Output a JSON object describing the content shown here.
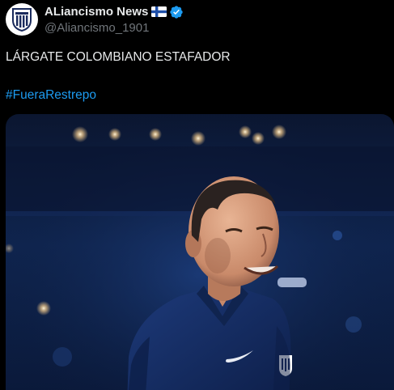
{
  "account": {
    "display_name": "ALiancismo News",
    "handle": "@Aliancismo_1901",
    "flag_icon": "finland-flag-icon",
    "verified_icon": "verified-badge-icon",
    "verified_color": "#1d9bf0"
  },
  "tweet": {
    "text": "LÁRGATE COLOMBIANO ESTAFADOR",
    "hashtag": "#FueraRestrepo"
  },
  "media": {
    "type": "photo"
  },
  "colors": {
    "background": "#000000",
    "primary_text": "#e7e9ea",
    "secondary_text": "#71767b",
    "link": "#1d9bf0"
  }
}
